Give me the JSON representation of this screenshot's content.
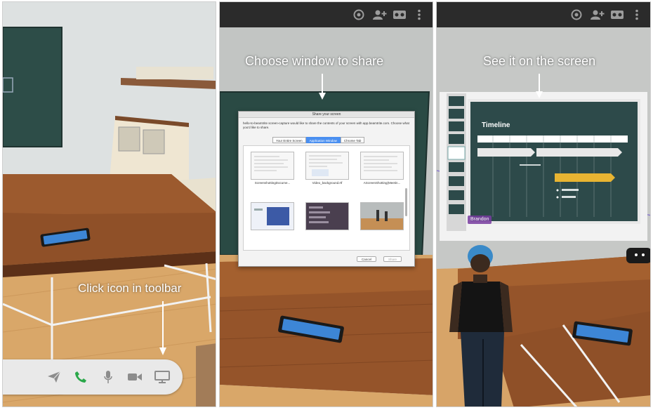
{
  "captions": {
    "toolbar_hint": "Click icon in toolbar",
    "choose_window": "Choose window to share",
    "see_screen": "See it on the screen"
  },
  "topbar": {
    "icons": [
      "settings-icon",
      "add-user-icon",
      "vr-headset-icon",
      "more-options-icon"
    ]
  },
  "toolbar": {
    "icons": [
      "send-icon",
      "phone-icon",
      "microphone-icon",
      "video-camera-icon",
      "screen-share-icon"
    ]
  },
  "share_dialog": {
    "title": "Share your screen",
    "description": "hello-to-beamtrite screen-capture would like to share the contents of your screen with app.beamtrite.com. Choose what you'd like to share.",
    "tabs": [
      "Your Entire Screen",
      "Application Window",
      "Chrome Tab"
    ],
    "active_tab": "Application Window",
    "windows": [
      "ScreenshottingDocume...",
      "Video_background.rtf",
      "AScreenShotting(Meetin..."
    ],
    "buttons": {
      "cancel": "Cancel",
      "share": "Share"
    }
  },
  "screen_view": {
    "slide_title": "Timeline",
    "user_tag": "Brandon"
  },
  "colors": {
    "wall": "#d8dcdc",
    "chalkboard": "#2d4d48",
    "desk": "#8a4b25",
    "topbar": "#2b2b2b",
    "toolbar": "#e9e9e9",
    "phone_green": "#2aa84a",
    "dialog_tab_active": "#4a8ff0"
  }
}
